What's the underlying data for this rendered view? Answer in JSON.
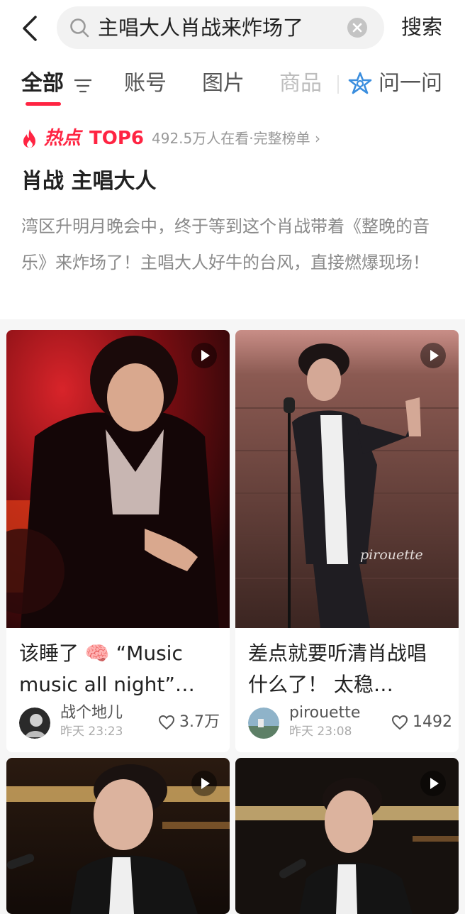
{
  "search": {
    "query": "主唱大人肖战来炸场了",
    "button_label": "搜索"
  },
  "tabs": [
    {
      "label": "全部",
      "state": "active"
    },
    {
      "label": "账号",
      "state": "normal"
    },
    {
      "label": "图片",
      "state": "normal"
    },
    {
      "label": "商品",
      "state": "faded"
    },
    {
      "label": "问一问",
      "state": "normal"
    }
  ],
  "hot_topic": {
    "label": "热点",
    "rank": "TOP6",
    "viewers": "492.5万人在看·完整榜单",
    "title": "肖战 主唱大人",
    "description": "湾区升明月晚会中，终于等到这个肖战带着《整晚的音乐》来炸场了！主唱大人好牛的台风，直接燃爆现场！"
  },
  "feed": [
    {
      "title": "该睡了 🧠 “Music music all night”…",
      "author": "战个地儿",
      "time": "昨天 23:23",
      "likes": "3.7万",
      "is_video": true
    },
    {
      "title": "差点就要听清肖战唱什么了！ 太稳…",
      "author": "pirouette",
      "time": "昨天 23:08",
      "likes": "1492",
      "watermark": "pirouette",
      "is_video": true
    },
    {
      "title": "",
      "author": "",
      "time": "",
      "likes": "",
      "is_video": true
    },
    {
      "title": "",
      "author": "",
      "time": "",
      "likes": "",
      "is_video": true
    }
  ],
  "colors": {
    "accent": "#ff2442",
    "ask_icon": "#3b8ede",
    "background": "#f6f6f6"
  }
}
